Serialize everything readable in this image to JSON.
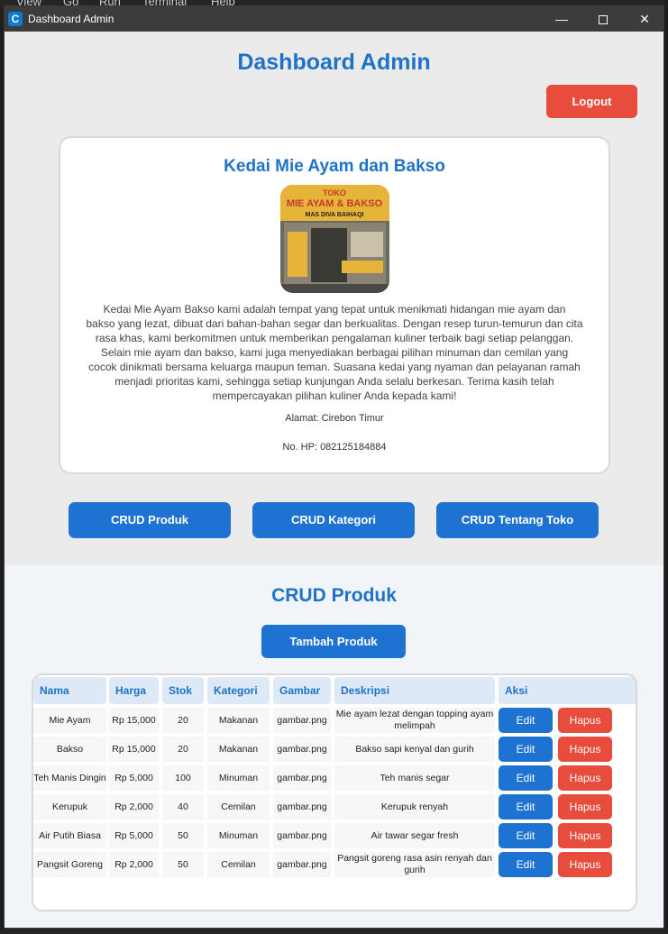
{
  "window": {
    "title": "Dashboard Admin"
  },
  "background_menu": [
    "View",
    "Go",
    "Run",
    "Terminal",
    "Help"
  ],
  "page": {
    "title": "Dashboard Admin",
    "logout_label": "Logout"
  },
  "store": {
    "name": "Kedai Mie Ayam dan Bakso",
    "image_sign_lines": [
      "TOKO",
      "MIE AYAM & BAKSO",
      "MAS DIVA BAIHAQI"
    ],
    "description_lines": [
      "Kedai Mie Ayam Bakso kami adalah tempat yang tepat untuk menikmati hidangan mie ayam dan",
      "bakso yang lezat, dibuat dari bahan-bahan segar dan berkualitas. Dengan resep turun-temurun dan cita",
      "rasa khas, kami berkomitmen untuk memberikan pengalaman kuliner terbaik bagi setiap pelanggan.",
      "Selain mie ayam dan bakso, kami juga menyediakan berbagai pilihan minuman dan cemilan yang",
      "cocok dinikmati bersama keluarga maupun teman. Suasana kedai yang nyaman dan pelayanan ramah",
      "menjadi prioritas kami, sehingga setiap kunjungan Anda selalu berkesan. Terima kasih telah",
      "mempercayakan pilihan kuliner Anda kepada kami!"
    ],
    "address": "Alamat: Cirebon Timur",
    "phone": "No. HP: 082125184884"
  },
  "nav": {
    "crud_produk": "CRUD Produk",
    "crud_kategori": "CRUD Kategori",
    "crud_tentang": "CRUD Tentang Toko"
  },
  "crud": {
    "title": "CRUD Produk",
    "add_label": "Tambah Produk",
    "headers": [
      "Nama",
      "Harga",
      "Stok",
      "Kategori",
      "Gambar",
      "Deskripsi",
      "Aksi"
    ],
    "edit_label": "Edit",
    "delete_label": "Hapus",
    "rows": [
      {
        "nama": "Mie Ayam",
        "harga": "Rp 15,000",
        "stok": "20",
        "kategori": "Makanan",
        "gambar": "gambar.png",
        "deskripsi": "Mie ayam lezat dengan topping ayam melimpah"
      },
      {
        "nama": "Bakso",
        "harga": "Rp 15,000",
        "stok": "20",
        "kategori": "Makanan",
        "gambar": "gambar.png",
        "deskripsi": "Bakso sapi kenyal dan gurih"
      },
      {
        "nama": "Teh Manis Dingin",
        "harga": "Rp 5,000",
        "stok": "100",
        "kategori": "Minuman",
        "gambar": "gambar.png",
        "deskripsi": "Teh manis segar"
      },
      {
        "nama": "Kerupuk",
        "harga": "Rp 2,000",
        "stok": "40",
        "kategori": "Cemilan",
        "gambar": "gambar.png",
        "deskripsi": "Kerupuk renyah"
      },
      {
        "nama": "Air Putih Biasa",
        "harga": "Rp 5,000",
        "stok": "50",
        "kategori": "Minuman",
        "gambar": "gambar.png",
        "deskripsi": "Air tawar segar fresh"
      },
      {
        "nama": "Pangsit Goreng",
        "harga": "Rp 2,000",
        "stok": "50",
        "kategori": "Cemilan",
        "gambar": "gambar.png",
        "deskripsi": "Pangsit goreng rasa asin renyah dan gurih"
      }
    ]
  },
  "colors": {
    "accent": "#1e73d2",
    "danger": "#e74c3c",
    "title_text": "#1e73c8"
  }
}
